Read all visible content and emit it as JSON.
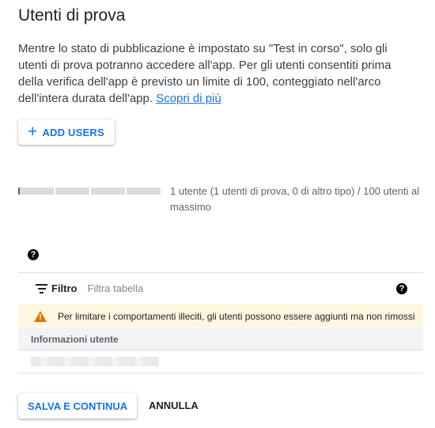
{
  "section": {
    "title": "Utenti di prova",
    "intro_text": "Mentre lo stato di pubblicazione è impostato su \"Test in corso\", solo gli utenti di prova potranno accedere all'app. Per gli utenti consentiti prima della verifica dell'app è previsto un limite di 100, conteggiato nell'arco dell'intera durata dell'app. ",
    "learn_more_link": "Scopri di più"
  },
  "add_users_button": {
    "icon": "plus-icon",
    "label": "ADD USERS"
  },
  "usage": {
    "text": "1 utente (1 utenti di prova, 0 di altro tipo) / 100 utenti al massimo",
    "current": 1,
    "max": 100
  },
  "help_icon": "?",
  "filter_bar": {
    "icon": "filter-icon",
    "label": "Filtro",
    "placeholder": "Filtra tabella",
    "help_icon": "?"
  },
  "warning": {
    "icon": "warning-icon",
    "icon_glyph": "!",
    "text": "Per limitare i comportamenti illeciti, gli utenti possono essere aggiunti ma non rimossi",
    "color": "#e37400"
  },
  "table": {
    "column_header": "Informazioni utente"
  },
  "footer": {
    "save_label": "SALVA E CONTINUA",
    "cancel_label": "ANNULLA"
  },
  "colors": {
    "accent": "#1a73e8",
    "warning_bg": "#fef7e0"
  }
}
